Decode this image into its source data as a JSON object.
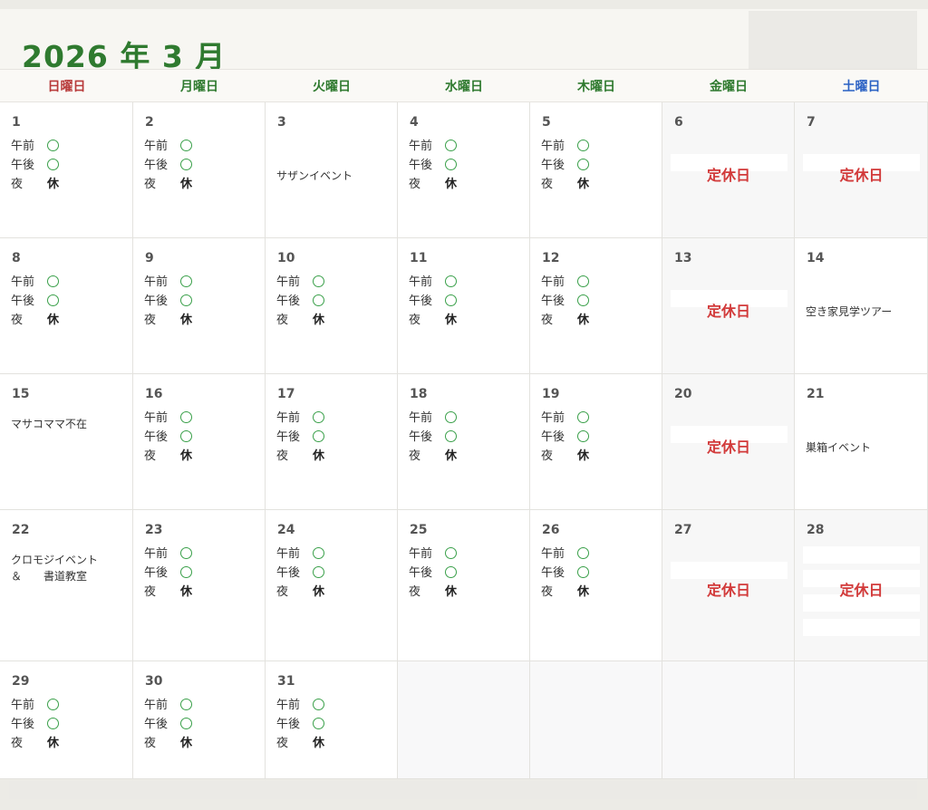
{
  "calendar": {
    "title": "2026 年 3 月",
    "weekdays": [
      "日曜日",
      "月曜日",
      "火曜日",
      "水曜日",
      "木曜日",
      "金曜日",
      "土曜日"
    ],
    "labels": {
      "morning": "午前",
      "afternoon": "午後",
      "night": "夜",
      "off": "休",
      "closed": "定休日"
    },
    "colors": {
      "title": "#2f7a2f",
      "sunday": "#b83a3a",
      "saturday": "#2b62c4",
      "closed": "#d23a3a",
      "available": "#3aa04a"
    },
    "availability_icon": "open-circle-icon",
    "days": [
      {
        "day": "1",
        "type": "schedule"
      },
      {
        "day": "2",
        "type": "schedule"
      },
      {
        "day": "3",
        "type": "note",
        "note": "サザンイベント"
      },
      {
        "day": "4",
        "type": "schedule"
      },
      {
        "day": "5",
        "type": "schedule"
      },
      {
        "day": "6",
        "type": "closed"
      },
      {
        "day": "7",
        "type": "closed"
      },
      {
        "day": "8",
        "type": "schedule"
      },
      {
        "day": "9",
        "type": "schedule"
      },
      {
        "day": "10",
        "type": "schedule"
      },
      {
        "day": "11",
        "type": "schedule"
      },
      {
        "day": "12",
        "type": "schedule"
      },
      {
        "day": "13",
        "type": "closed"
      },
      {
        "day": "14",
        "type": "note",
        "note": "空き家見学ツアー"
      },
      {
        "day": "15",
        "type": "note",
        "note": "マサコママ不在"
      },
      {
        "day": "16",
        "type": "schedule"
      },
      {
        "day": "17",
        "type": "schedule"
      },
      {
        "day": "18",
        "type": "schedule"
      },
      {
        "day": "19",
        "type": "schedule"
      },
      {
        "day": "20",
        "type": "closed"
      },
      {
        "day": "21",
        "type": "note",
        "note": "巣箱イベント"
      },
      {
        "day": "22",
        "type": "note",
        "note": "クロモジイベント",
        "note2": "＆　　書道教室"
      },
      {
        "day": "23",
        "type": "schedule"
      },
      {
        "day": "24",
        "type": "schedule"
      },
      {
        "day": "25",
        "type": "schedule"
      },
      {
        "day": "26",
        "type": "schedule"
      },
      {
        "day": "27",
        "type": "closed"
      },
      {
        "day": "28",
        "type": "closed"
      },
      {
        "day": "29",
        "type": "schedule"
      },
      {
        "day": "30",
        "type": "schedule"
      },
      {
        "day": "31",
        "type": "schedule"
      },
      {
        "day": "",
        "type": "empty"
      },
      {
        "day": "",
        "type": "empty"
      },
      {
        "day": "",
        "type": "empty"
      },
      {
        "day": "",
        "type": "empty"
      }
    ]
  }
}
